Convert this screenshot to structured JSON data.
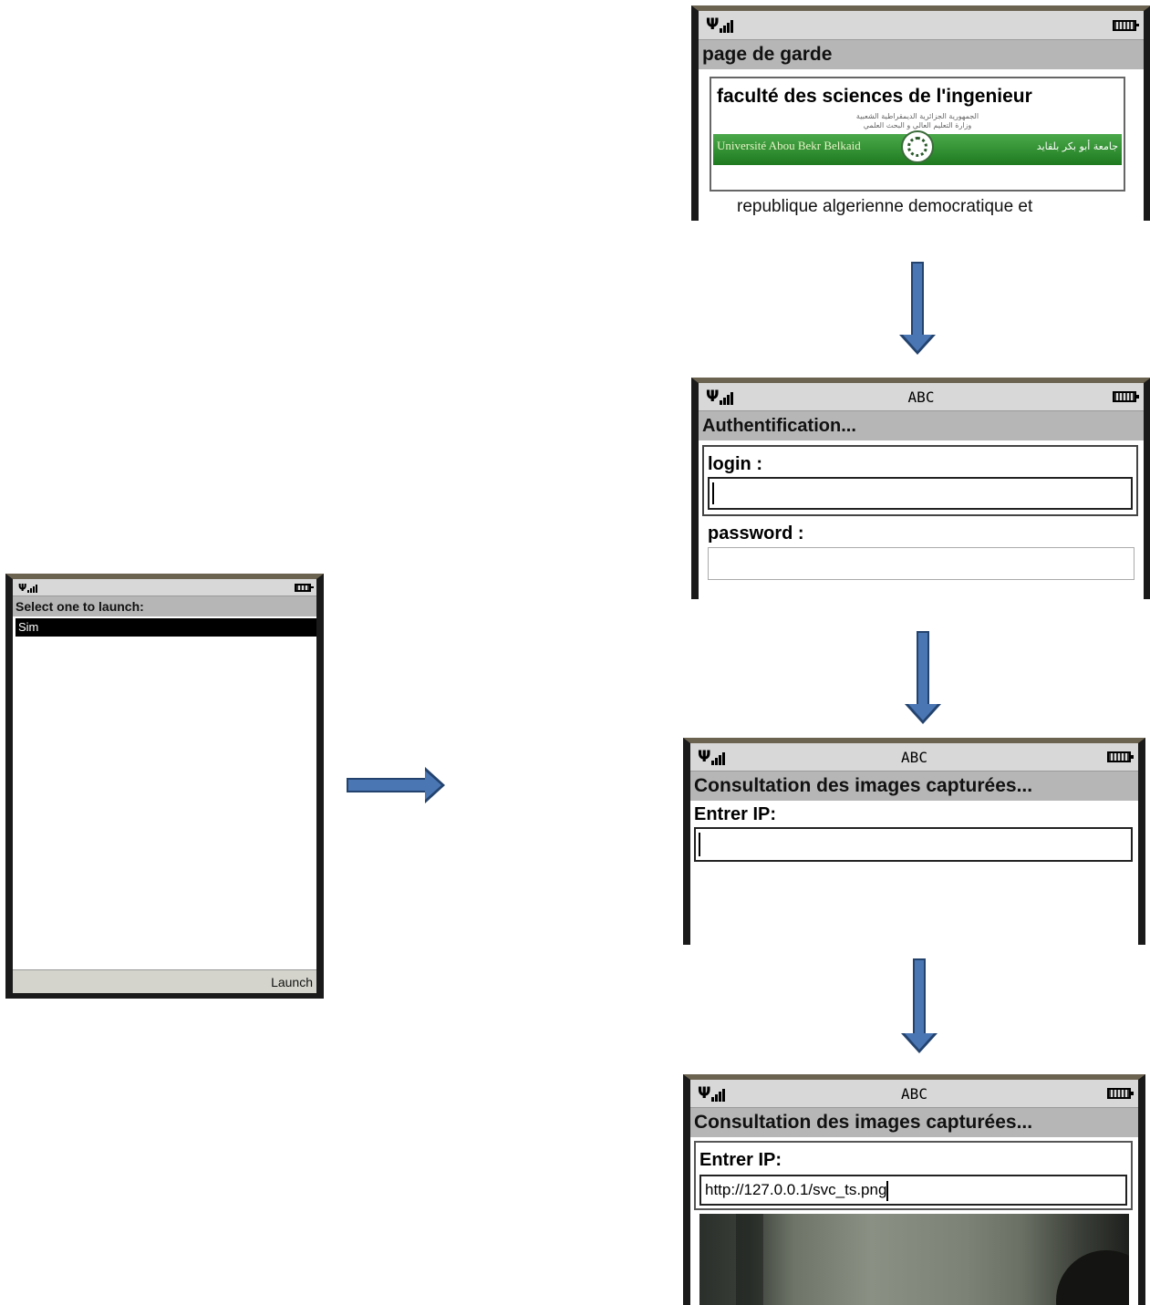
{
  "launcher": {
    "title": "Select one to launch:",
    "selected_item": "Sim",
    "softkey": "Launch"
  },
  "splash": {
    "title": "page de garde",
    "heading": "faculté des sciences de l'ingenieur",
    "arabic_line_1": "الجمهورية الجزائرية الديمقراطية الشعبية",
    "arabic_line_2": "وزارة التعليم العالي و البحث العلمي",
    "banner_left": "Université Abou Bekr Belkaid",
    "banner_right": "جامعة أبو بكر بلقايد",
    "body_text": "republique algerienne democratique et"
  },
  "auth": {
    "mode": "ABC",
    "title": "Authentification...",
    "login_label": "login :",
    "password_label": "password :"
  },
  "consult_empty": {
    "mode": "ABC",
    "title": "Consultation des images capturées...",
    "ip_label": "Entrer IP:"
  },
  "consult_filled": {
    "mode": "ABC",
    "title": "Consultation des images capturées...",
    "ip_label": "Entrer IP:",
    "ip_value": "http://127.0.0.1/svc_ts.png"
  },
  "colors": {
    "arrow_fill": "#4a76b4",
    "arrow_stroke": "#23436e",
    "banner_green": "#2e8b2e",
    "title_bar_gray": "#b6b6b6"
  }
}
